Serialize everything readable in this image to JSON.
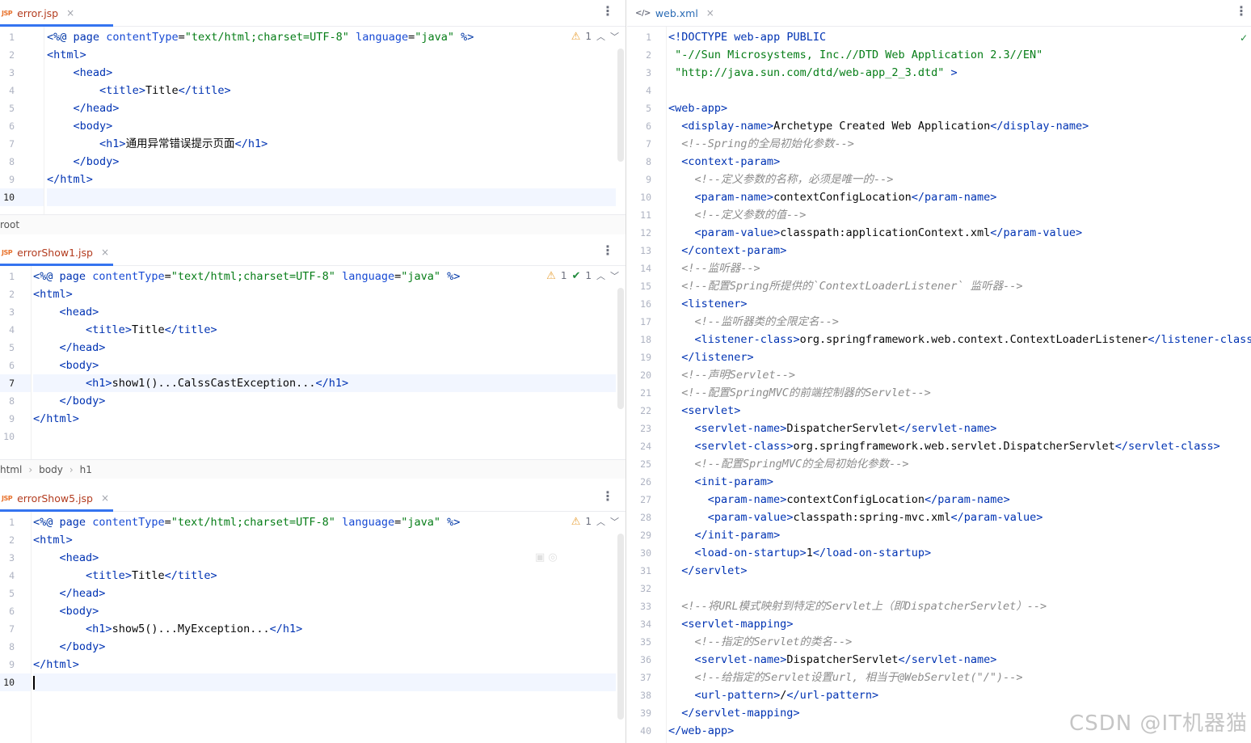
{
  "left_panes": [
    {
      "tab": {
        "icon": "jsp-file-icon",
        "icon_text": "JSP",
        "label": "error.jsp",
        "close": "×"
      },
      "status": {
        "warnings": "1",
        "checks": ""
      },
      "lines": [
        "<%@ page contentType=\"text/html;charset=UTF-8\" language=\"java\" %>",
        "<html>",
        "    <head>",
        "        <title>Title</title>",
        "    </head>",
        "    <body>",
        "        <h1>通用异常错误提示页面</h1>",
        "    </body>",
        "</html>",
        ""
      ],
      "breadcrumb": [
        "root"
      ]
    },
    {
      "tab": {
        "icon": "jsp-file-icon",
        "icon_text": "JSP",
        "label": "errorShow1.jsp",
        "close": "×"
      },
      "status": {
        "warnings": "1",
        "checks": "1"
      },
      "lines": [
        "<%@ page contentType=\"text/html;charset=UTF-8\" language=\"java\" %>",
        "<html>",
        "    <head>",
        "        <title>Title</title>",
        "    </head>",
        "    <body>",
        "        <h1>show1()...CalssCastException...</h1>",
        "    </body>",
        "</html>",
        ""
      ],
      "breadcrumb": [
        "html",
        "body",
        "h1"
      ]
    },
    {
      "tab": {
        "icon": "jsp-file-icon",
        "icon_text": "JSP",
        "label": "errorShow5.jsp",
        "close": "×"
      },
      "status": {
        "warnings": "1",
        "checks": ""
      },
      "lines": [
        "<%@ page contentType=\"text/html;charset=UTF-8\" language=\"java\" %>",
        "<html>",
        "    <head>",
        "        <title>Title</title>",
        "    </head>",
        "    <body>",
        "        <h1>show5()...MyException...</h1>",
        "    </body>",
        "</html>",
        ""
      ]
    }
  ],
  "right_pane": {
    "tab": {
      "icon": "xml-file-icon",
      "icon_text": "</>",
      "label": "web.xml",
      "close": "×"
    },
    "lines": [
      "<!DOCTYPE web-app PUBLIC",
      " \"-//Sun Microsystems, Inc.//DTD Web Application 2.3//EN\"",
      " \"http://java.sun.com/dtd/web-app_2_3.dtd\" >",
      "",
      "<web-app>",
      "  <display-name>Archetype Created Web Application</display-name>",
      "  <!--Spring的全局初始化参数-->",
      "  <context-param>",
      "    <!--定义参数的名称，必须是唯一的-->",
      "    <param-name>contextConfigLocation</param-name>",
      "    <!--定义参数的值-->",
      "    <param-value>classpath:applicationContext.xml</param-value>",
      "  </context-param>",
      "  <!--监听器-->",
      "  <!--配置Spring所提供的`ContextLoaderListener` 监听器-->",
      "  <listener>",
      "    <!--监听器类的全限定名-->",
      "    <listener-class>org.springframework.web.context.ContextLoaderListener</listener-class>",
      "  </listener>",
      "  <!--声明Servlet-->",
      "  <!--配置SpringMVC的前端控制器的Servlet-->",
      "  <servlet>",
      "    <servlet-name>DispatcherServlet</servlet-name>",
      "    <servlet-class>org.springframework.web.servlet.DispatcherServlet</servlet-class>",
      "    <!--配置SpringMVC的全局初始化参数-->",
      "    <init-param>",
      "      <param-name>contextConfigLocation</param-name>",
      "      <param-value>classpath:spring-mvc.xml</param-value>",
      "    </init-param>",
      "    <load-on-startup>1</load-on-startup>",
      "  </servlet>",
      "",
      "  <!--将URL模式映射到特定的Servlet上（即DispatcherServlet）-->",
      "  <servlet-mapping>",
      "    <!--指定的Servlet的类名-->",
      "    <servlet-name>DispatcherServlet</servlet-name>",
      "    <!--给指定的Servlet设置url, 相当于@WebServlet(\"/\")-->",
      "    <url-pattern>/</url-pattern>",
      "  </servlet-mapping>",
      "</web-app>"
    ]
  },
  "watermark": "CSDN @IT机器猫",
  "colors": {
    "tag": "#0033b3",
    "attr": "#174ad4",
    "value": "#067d17",
    "comment": "#8c8c8c",
    "tab_underline": "#3574f0",
    "line_highlight": "#f2f6ff",
    "warning": "#e8a33d"
  }
}
